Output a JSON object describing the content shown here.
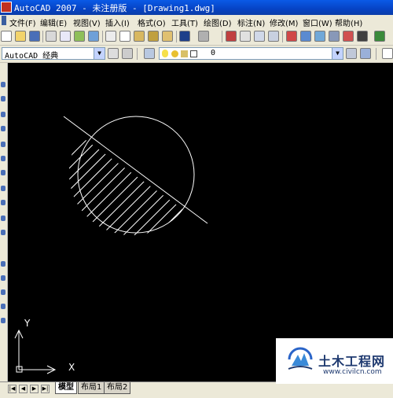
{
  "titlebar": {
    "title": "AutoCAD 2007 - 未注册版 - [Drawing1.dwg]"
  },
  "menubar": {
    "items": [
      "文件(F)",
      "编辑(E)",
      "视图(V)",
      "插入(I)",
      "格式(O)",
      "工具(T)",
      "绘图(D)",
      "标注(N)",
      "修改(M)",
      "窗口(W)",
      "帮助(H)"
    ]
  },
  "workspace": {
    "value": "AutoCAD 经典"
  },
  "layer": {
    "value": "0"
  },
  "ucs": {
    "x_label": "X",
    "y_label": "Y"
  },
  "tabs": [
    "模型",
    "布局1",
    "布局2"
  ],
  "watermark": {
    "name": "土木工程网",
    "url": "www.civilcn.com"
  },
  "colors": {
    "canvas": "#000000",
    "titlebar": "#0a5ae6",
    "geometry": "#ffffff"
  }
}
